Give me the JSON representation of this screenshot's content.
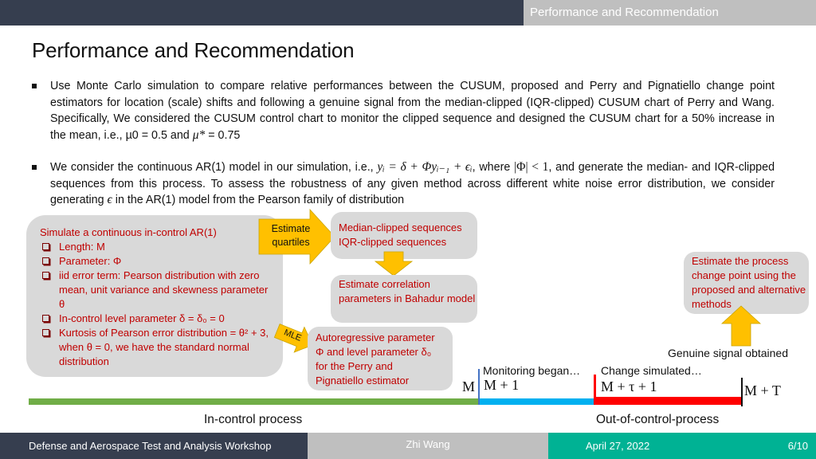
{
  "header": {
    "section_label": "Performance and Recommendation",
    "title": "Performance and Recommendation"
  },
  "bullets": [
    {
      "text_a": "Use Monte Carlo simulation to compare relative performances between the CUSUM, proposed and Perry and Pignatiello change point estimators for location (scale) shifts and following a genuine signal from the median-clipped (IQR-clipped) CUSUM chart of Perry and Wang. Specifically, We considered the CUSUM control chart to monitor the clipped sequence and designed the CUSUM chart for a 50% increase in the mean, i.e., µ0 = 0.5 and ",
      "math_a": "μ*",
      "text_b": " = 0.75"
    },
    {
      "text_a": "We consider the continuous AR(1) model in our simulation, i.e., ",
      "math_a": "yᵢ = δ + Φyᵢ₋₁ + ϵᵢ",
      "text_b": ", where ",
      "math_b": "|Φ| < 1",
      "text_c": ", and generate the median- and IQR-clipped sequences from this process. To assess the robustness of any given method across different white noise error distribution, we consider generating ",
      "math_c": "ϵ",
      "text_d": " in the AR(1) model from the Pearson family of distribution"
    }
  ],
  "diagram": {
    "simulate_box": {
      "heading": "Simulate a continuous in-control AR(1)",
      "items": [
        "Length: M",
        "Parameter: Φ",
        "iid error term: Pearson distribution with zero mean, unit variance and skewness parameter θ",
        "In-control level parameter δ = δ₀ = 0",
        "Kurtosis of Pearson error distribution = θ² + 3, when θ = 0, we have the standard normal distribution"
      ]
    },
    "arrow_estimate_quartiles": {
      "line1": "Estimate",
      "line2": "quartiles"
    },
    "arrow_mle": {
      "label": "MLE"
    },
    "median_box": {
      "line1": "Median-clipped sequences",
      "line2": "IQR-clipped sequences"
    },
    "correlation_box": {
      "text": "Estimate correlation parameters in Bahadur model"
    },
    "autoregressive_box": {
      "line1": "Autoregressive parameter",
      "line2": "Φ and level parameter δ₀",
      "line3": "for the Perry and",
      "line4": "Pignatiello  estimator"
    },
    "estimate_box": {
      "text": "Estimate the process change point using the proposed and alternative methods"
    },
    "genuine_signal": "Genuine signal obtained",
    "timeline": {
      "monitoring_label": "Monitoring began…",
      "change_label": "Change simulated…",
      "m_label": "M",
      "m_plus_1": "M + 1",
      "m_tau_1": "M + τ + 1",
      "m_plus_t": "M + T",
      "in_control_label": "In-control process",
      "out_of_control_label": "Out-of-control-process"
    },
    "colors": {
      "in_control": "#70ad47",
      "monitoring": "#00b0f0",
      "out_of_control": "#ff0000",
      "arrow": "#ffc000",
      "box_fill": "#d9d9d9",
      "box_text": "#c00000"
    }
  },
  "footer": {
    "event": "Defense and Aerospace Test and Analysis Workshop",
    "author": "Zhi Wang",
    "date": "April 27, 2022",
    "page": "6/10"
  }
}
